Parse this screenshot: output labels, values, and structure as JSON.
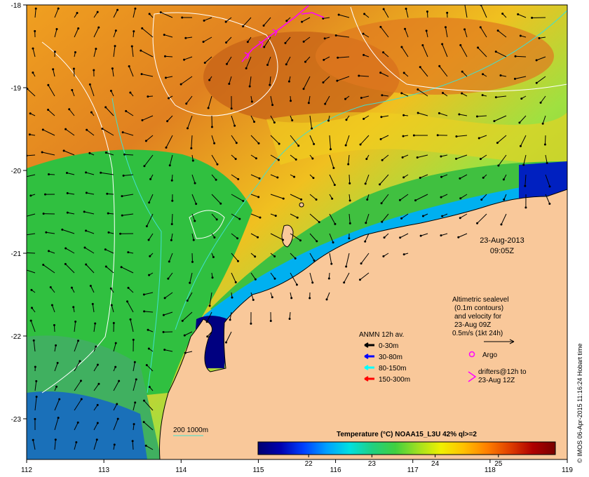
{
  "map": {
    "lon_ticks": [
      "112",
      "113",
      "114",
      "115",
      "116",
      "117",
      "118",
      "119"
    ],
    "lat_ticks": [
      "-18",
      "-19",
      "-20",
      "-21",
      "-22",
      "-23"
    ],
    "date": "23-Aug-2013",
    "time": "09:05Z",
    "credit": "© IMOS 06-Apr-2015 11:16:24 Hobart time",
    "colors": {
      "land": "#f9c89a",
      "isobath_200": "#40e0d0",
      "isobath_1000": "#40e0d0",
      "sealevel_contour": "#ffffff",
      "drifter": "#ff00ff",
      "argo": "#ff00ff"
    }
  },
  "altimetry": {
    "line1": "Altimetric sealevel",
    "line2": "(0.1m contours)",
    "line3": "and velocity for",
    "line4": "23-Aug 09Z",
    "line5": "0.5m/s (1kt 24h)"
  },
  "anmn": {
    "title": "ANMN 12h av.",
    "items": [
      {
        "label": "0-30m",
        "color": "#000000"
      },
      {
        "label": "30-80m",
        "color": "#0000ff"
      },
      {
        "label": "80-150m",
        "color": "#00ffff"
      },
      {
        "label": "150-300m",
        "color": "#ff0000"
      }
    ]
  },
  "argo": {
    "label": "Argo"
  },
  "drifters": {
    "line1": "drifters@12h to",
    "line2": "23-Aug 12Z"
  },
  "isobath": {
    "label": "200  1000m"
  },
  "colorbar": {
    "title": "Temperature (°C) NOAA15_L3U 42% ql>=2",
    "ticks": [
      "22",
      "23",
      "24",
      "25"
    ],
    "tick_values": [
      22,
      23,
      24,
      25
    ],
    "range": [
      21.2,
      25.9
    ],
    "stops": [
      "#000070",
      "#0000b0",
      "#0040ff",
      "#00a0ff",
      "#00e0e0",
      "#20d080",
      "#40d040",
      "#a0e020",
      "#f0f000",
      "#ffc000",
      "#ff8000",
      "#e04000",
      "#b00000",
      "#780000"
    ]
  }
}
